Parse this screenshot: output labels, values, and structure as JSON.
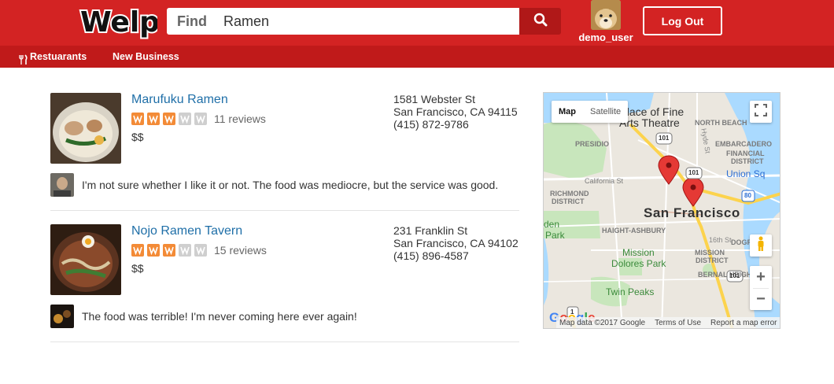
{
  "header": {
    "logo_text": "Welp",
    "search": {
      "label": "Find",
      "value": "Ramen"
    },
    "user": {
      "name": "demo_user"
    },
    "logout_label": "Log Out"
  },
  "nav": {
    "items": [
      {
        "label": "Restuarants",
        "icon": "utensils-icon"
      },
      {
        "label": "New Business"
      }
    ]
  },
  "results": [
    {
      "name": "Marufuku Ramen",
      "rating": 3,
      "max_rating": 5,
      "reviews": "11 reviews",
      "price": "$$",
      "address": [
        "1581 Webster St",
        "San Francisco, CA 94115",
        "(415) 872-9786"
      ],
      "review_text": "I'm not sure whether I like it or not. The food was mediocre, but the service was good."
    },
    {
      "name": "Nojo Ramen Tavern",
      "rating": 3,
      "max_rating": 5,
      "reviews": "15 reviews",
      "price": "$$",
      "address": [
        "231 Franklin St",
        "San Francisco, CA 94102",
        "(415) 896-4587"
      ],
      "review_text": "The food was terrible! I'm never coming here ever again!"
    }
  ],
  "map": {
    "type_buttons": [
      "Map",
      "Satellite"
    ],
    "labels": {
      "palace": "alace of Fine",
      "arts": "Arts Theatre",
      "north_beach": "NORTH BEACH",
      "presidio": "PRESIDIO",
      "embarcadero": "EMBARCADERO",
      "financial": "FINANCIAL",
      "district": "DISTRICT",
      "union_sq": "Union Sq",
      "california": "California St",
      "richmond": "RICHMOND",
      "richmond_district": "DISTRICT",
      "city": "San Francisco",
      "golden_gate": "den",
      "park": "Park",
      "haight": "HAIGHT-ASHBURY",
      "dogpatch": "DOGPATCH",
      "mission": "Mission",
      "dolores": "Dolores Park",
      "mission_district": "MISSION",
      "mission_district2": "DISTRICT",
      "bernal": "BERNAL HEIGHTS",
      "twin_peaks": "Twin Peaks",
      "hyde": "Hyde St",
      "sixteenth": "16th St",
      "hwy101a": "101",
      "hwy101b": "101",
      "hwy101c": "101",
      "hwy80": "80",
      "hwy1": "1"
    },
    "google": "Google",
    "footer": [
      "Map data ©2017 Google",
      "Terms of Use",
      "Report a map error"
    ],
    "zoom_in": "+",
    "zoom_out": "−"
  },
  "colors": {
    "brand_red": "#d32323",
    "nav_red": "#c01a1a",
    "link_blue": "#1f6fa8",
    "star_on": "#f38b37",
    "star_off": "#cfcfcf"
  }
}
